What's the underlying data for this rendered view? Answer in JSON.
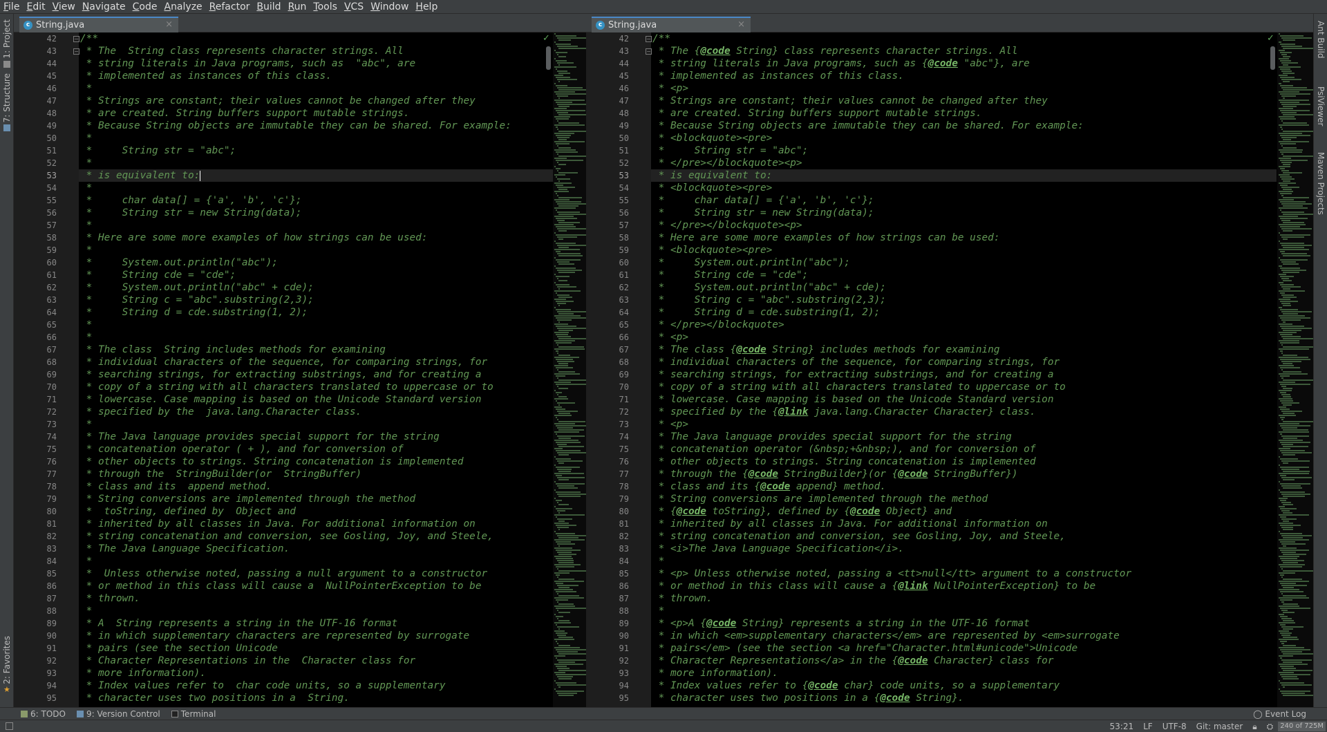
{
  "menu": [
    {
      "label": "File"
    },
    {
      "label": "Edit"
    },
    {
      "label": "View"
    },
    {
      "label": "Navigate"
    },
    {
      "label": "Code"
    },
    {
      "label": "Analyze"
    },
    {
      "label": "Refactor"
    },
    {
      "label": "Build"
    },
    {
      "label": "Run"
    },
    {
      "label": "Tools"
    },
    {
      "label": "VCS"
    },
    {
      "label": "Window"
    },
    {
      "label": "Help"
    }
  ],
  "left_tools": {
    "project": "1: Project",
    "structure": "7: Structure",
    "favorites": "2: Favorites"
  },
  "right_tools": {
    "ant": "Ant Build",
    "psi": "PsiViewer",
    "maven": "Maven Projects"
  },
  "left_pane": {
    "tab": "String.java",
    "first_line": 42,
    "current_line": 53,
    "lines": [
      [
        {
          "t": "/**"
        }
      ],
      [
        {
          "t": " * The  String class represents character strings. All"
        }
      ],
      [
        {
          "t": " * string literals in Java programs, such as  \"abc\", are"
        }
      ],
      [
        {
          "t": " * implemented as instances of this class."
        }
      ],
      [
        {
          "t": " *"
        }
      ],
      [
        {
          "t": " * Strings are constant; their values cannot be changed after they"
        }
      ],
      [
        {
          "t": " * are created. String buffers support mutable strings."
        }
      ],
      [
        {
          "t": " * Because String objects are immutable they can be shared. For example:"
        }
      ],
      [
        {
          "t": " *"
        }
      ],
      [
        {
          "t": " *     String str = \"abc\";"
        }
      ],
      [
        {
          "t": " *"
        }
      ],
      [
        {
          "t": " * is equivalent to:"
        }
      ],
      [
        {
          "t": " *"
        }
      ],
      [
        {
          "t": " *     char data[] = {'a', 'b', 'c'};"
        }
      ],
      [
        {
          "t": " *     String str = new String(data);"
        }
      ],
      [
        {
          "t": " *"
        }
      ],
      [
        {
          "t": " * Here are some more examples of how strings can be used:"
        }
      ],
      [
        {
          "t": " *"
        }
      ],
      [
        {
          "t": " *     System.out.println(\"abc\");"
        }
      ],
      [
        {
          "t": " *     String cde = \"cde\";"
        }
      ],
      [
        {
          "t": " *     System.out.println(\"abc\" + cde);"
        }
      ],
      [
        {
          "t": " *     String c = \"abc\".substring(2,3);"
        }
      ],
      [
        {
          "t": " *     String d = cde.substring(1, 2);"
        }
      ],
      [
        {
          "t": " *"
        }
      ],
      [
        {
          "t": " *"
        }
      ],
      [
        {
          "t": " * The class  String includes methods for examining"
        }
      ],
      [
        {
          "t": " * individual characters of the sequence, for comparing strings, for"
        }
      ],
      [
        {
          "t": " * searching strings, for extracting substrings, and for creating a"
        }
      ],
      [
        {
          "t": " * copy of a string with all characters translated to uppercase or to"
        }
      ],
      [
        {
          "t": " * lowercase. Case mapping is based on the Unicode Standard version"
        }
      ],
      [
        {
          "t": " * specified by the  java.lang.Character class."
        }
      ],
      [
        {
          "t": " *"
        }
      ],
      [
        {
          "t": " * The Java language provides special support for the string"
        }
      ],
      [
        {
          "t": " * concatenation operator ( + ), and for conversion of"
        }
      ],
      [
        {
          "t": " * other objects to strings. String concatenation is implemented"
        }
      ],
      [
        {
          "t": " * through the  StringBuilder(or  StringBuffer)"
        }
      ],
      [
        {
          "t": " * class and its  append method."
        }
      ],
      [
        {
          "t": " * String conversions are implemented through the method"
        }
      ],
      [
        {
          "t": " *  toString, defined by  Object and"
        }
      ],
      [
        {
          "t": " * inherited by all classes in Java. For additional information on"
        }
      ],
      [
        {
          "t": " * string concatenation and conversion, see Gosling, Joy, and Steele,"
        }
      ],
      [
        {
          "t": " * The Java Language Specification."
        }
      ],
      [
        {
          "t": " *"
        }
      ],
      [
        {
          "t": " *  Unless otherwise noted, passing a null argument to a constructor"
        }
      ],
      [
        {
          "t": " * or method in this class will cause a  NullPointerException to be"
        }
      ],
      [
        {
          "t": " * thrown."
        }
      ],
      [
        {
          "t": " *"
        }
      ],
      [
        {
          "t": " * A  String represents a string in the UTF-16 format"
        }
      ],
      [
        {
          "t": " * in which supplementary characters are represented by surrogate"
        }
      ],
      [
        {
          "t": " * pairs (see the section Unicode"
        }
      ],
      [
        {
          "t": " * Character Representations in the  Character class for"
        }
      ],
      [
        {
          "t": " * more information)."
        }
      ],
      [
        {
          "t": " * Index values refer to  char code units, so a supplementary"
        }
      ],
      [
        {
          "t": " * character uses two positions in a  String."
        }
      ]
    ]
  },
  "right_pane": {
    "tab": "String.java",
    "first_line": 42,
    "current_line": 53,
    "lines": [
      [
        {
          "t": "/**"
        }
      ],
      [
        {
          "t": " * The {"
        },
        {
          "t": "@code",
          "k": "tag"
        },
        {
          "t": " String} class represents character strings. All"
        }
      ],
      [
        {
          "t": " * string literals in Java programs, such as {"
        },
        {
          "t": "@code",
          "k": "tag"
        },
        {
          "t": " \"abc\"}, are"
        }
      ],
      [
        {
          "t": " * implemented as instances of this class."
        }
      ],
      [
        {
          "t": " * <p>"
        }
      ],
      [
        {
          "t": " * Strings are constant; their values cannot be changed after they"
        }
      ],
      [
        {
          "t": " * are created. String buffers support mutable strings."
        }
      ],
      [
        {
          "t": " * Because String objects are immutable they can be shared. For example:"
        }
      ],
      [
        {
          "t": " * <blockquote><pre>"
        }
      ],
      [
        {
          "t": " *     String str = \"abc\";"
        }
      ],
      [
        {
          "t": " * </pre></blockquote><p>"
        }
      ],
      [
        {
          "t": " * is equivalent to:"
        }
      ],
      [
        {
          "t": " * <blockquote><pre>"
        }
      ],
      [
        {
          "t": " *     char data[] = {'a', 'b', 'c'};"
        }
      ],
      [
        {
          "t": " *     String str = new String(data);"
        }
      ],
      [
        {
          "t": " * </pre></blockquote><p>"
        }
      ],
      [
        {
          "t": " * Here are some more examples of how strings can be used:"
        }
      ],
      [
        {
          "t": " * <blockquote><pre>"
        }
      ],
      [
        {
          "t": " *     System.out.println(\"abc\");"
        }
      ],
      [
        {
          "t": " *     String cde = \"cde\";"
        }
      ],
      [
        {
          "t": " *     System.out.println(\"abc\" + cde);"
        }
      ],
      [
        {
          "t": " *     String c = \"abc\".substring(2,3);"
        }
      ],
      [
        {
          "t": " *     String d = cde.substring(1, 2);"
        }
      ],
      [
        {
          "t": " * </pre></blockquote>"
        }
      ],
      [
        {
          "t": " * <p>"
        }
      ],
      [
        {
          "t": " * The class {"
        },
        {
          "t": "@code",
          "k": "tag"
        },
        {
          "t": " String} includes methods for examining"
        }
      ],
      [
        {
          "t": " * individual characters of the sequence, for comparing strings, for"
        }
      ],
      [
        {
          "t": " * searching strings, for extracting substrings, and for creating a"
        }
      ],
      [
        {
          "t": " * copy of a string with all characters translated to uppercase or to"
        }
      ],
      [
        {
          "t": " * lowercase. Case mapping is based on the Unicode Standard version"
        }
      ],
      [
        {
          "t": " * specified by the {"
        },
        {
          "t": "@link",
          "k": "tag"
        },
        {
          "t": " java.lang.Character Character} class."
        }
      ],
      [
        {
          "t": " * <p>"
        }
      ],
      [
        {
          "t": " * The Java language provides special support for the string"
        }
      ],
      [
        {
          "t": " * concatenation operator (&nbsp;+&nbsp;), and for conversion of"
        }
      ],
      [
        {
          "t": " * other objects to strings. String concatenation is implemented"
        }
      ],
      [
        {
          "t": " * through the {"
        },
        {
          "t": "@code",
          "k": "tag"
        },
        {
          "t": " StringBuilder}(or {"
        },
        {
          "t": "@code",
          "k": "tag"
        },
        {
          "t": " StringBuffer})"
        }
      ],
      [
        {
          "t": " * class and its {"
        },
        {
          "t": "@code",
          "k": "tag"
        },
        {
          "t": " append} method."
        }
      ],
      [
        {
          "t": " * String conversions are implemented through the method"
        }
      ],
      [
        {
          "t": " * {"
        },
        {
          "t": "@code",
          "k": "tag"
        },
        {
          "t": " toString}, defined by {"
        },
        {
          "t": "@code",
          "k": "tag"
        },
        {
          "t": " Object} and"
        }
      ],
      [
        {
          "t": " * inherited by all classes in Java. For additional information on"
        }
      ],
      [
        {
          "t": " * string concatenation and conversion, see Gosling, Joy, and Steele,"
        }
      ],
      [
        {
          "t": " * <i>The Java Language Specification</i>."
        }
      ],
      [
        {
          "t": " *"
        }
      ],
      [
        {
          "t": " * <p> Unless otherwise noted, passing a <tt>null</tt> argument to a constructor"
        }
      ],
      [
        {
          "t": " * or method in this class will cause a {"
        },
        {
          "t": "@link",
          "k": "tag"
        },
        {
          "t": " NullPointerException} to be"
        }
      ],
      [
        {
          "t": " * thrown."
        }
      ],
      [
        {
          "t": " *"
        }
      ],
      [
        {
          "t": " * <p>A {"
        },
        {
          "t": "@code",
          "k": "tag"
        },
        {
          "t": " String} represents a string in the UTF-16 format"
        }
      ],
      [
        {
          "t": " * in which <em>supplementary characters</em> are represented by <em>surrogate"
        }
      ],
      [
        {
          "t": " * pairs</em> (see the section <a href=\"Character.html#unicode\">Unicode"
        }
      ],
      [
        {
          "t": " * Character Representations</a> in the {"
        },
        {
          "t": "@code",
          "k": "tag"
        },
        {
          "t": " Character} class for"
        }
      ],
      [
        {
          "t": " * more information)."
        }
      ],
      [
        {
          "t": " * Index values refer to {"
        },
        {
          "t": "@code",
          "k": "tag"
        },
        {
          "t": " char} code units, so a supplementary"
        }
      ],
      [
        {
          "t": " * character uses two positions in a {"
        },
        {
          "t": "@code",
          "k": "tag"
        },
        {
          "t": " String}."
        }
      ]
    ]
  },
  "bottom_tools": {
    "todo": "6: TODO",
    "vcs": "9: Version Control",
    "terminal": "Terminal",
    "event_log": "Event Log"
  },
  "status": {
    "position": "53:21",
    "line_sep": "LF",
    "encoding": "UTF-8",
    "git": "Git: master",
    "memory": "240 of 725M"
  },
  "colors": {
    "comment": "#629755",
    "doc_tag": "#77b767",
    "editor_bg": "#000000",
    "chrome_bg": "#3c3f41"
  }
}
